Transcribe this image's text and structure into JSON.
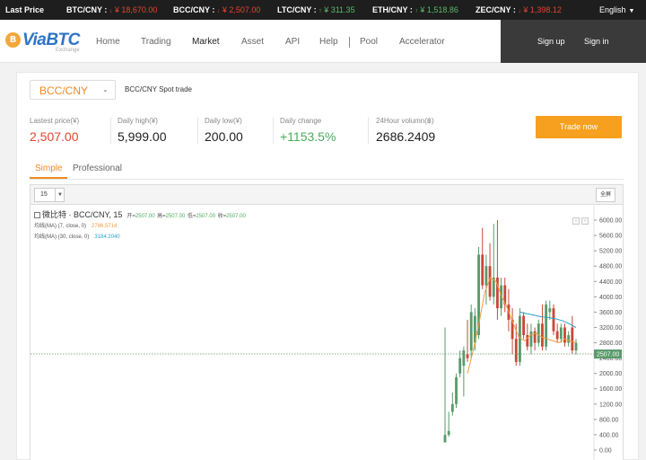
{
  "ticker": {
    "last_price_label": "Last Price",
    "items": [
      {
        "pair": "BTC/CNY :",
        "price": "¥ 18,670.00",
        "dir": "down"
      },
      {
        "pair": "BCC/CNY :",
        "price": "¥ 2,507.00",
        "dir": "down"
      },
      {
        "pair": "LTC/CNY :",
        "price": "¥ 311.35",
        "dir": "up"
      },
      {
        "pair": "ETH/CNY :",
        "price": "¥ 1,518.86",
        "dir": "up"
      },
      {
        "pair": "ZEC/CNY :",
        "price": "¥ 1,398.12",
        "dir": "down"
      }
    ],
    "language": "English"
  },
  "header": {
    "logo_text": "ViaBTC",
    "logo_sub": "Exchange",
    "nav": [
      "Home",
      "Trading",
      "Market",
      "Asset",
      "API",
      "Help",
      "Pool",
      "Accelerator"
    ],
    "active_nav": "Market",
    "sign_up": "Sign up",
    "sign_in": "Sign in"
  },
  "market": {
    "pair": "BCC/CNY",
    "spot_label": "BCC/CNY Spot trade",
    "stats": [
      {
        "label": "Lastest price(¥)",
        "value": "2,507.00",
        "color": "red"
      },
      {
        "label": "Daily high(¥)",
        "value": "5,999.00",
        "color": "normal"
      },
      {
        "label": "Daily low(¥)",
        "value": "200.00",
        "color": "normal"
      },
      {
        "label": "Daily change",
        "value": "+1153.5%",
        "color": "green"
      },
      {
        "label": "24Hour volumn(฿)",
        "value": "2686.2409",
        "color": "normal"
      }
    ],
    "trade_button": "Trade now",
    "tabs": [
      "Simple",
      "Professional"
    ],
    "active_tab": "Simple"
  },
  "chart_toolbar": {
    "interval": "15",
    "fullscreen_label": "全屏"
  },
  "chart_legend": {
    "title": "微比特 · BCC/CNY, 15",
    "ohlc": [
      {
        "label": "开=",
        "value": "2507.00"
      },
      {
        "label": "高=",
        "value": "2507.00"
      },
      {
        "label": "低=",
        "value": "2507.00"
      },
      {
        "label": "收=",
        "value": "2507.00"
      }
    ],
    "ma7": {
      "label": "均线(MA) (7, close, 0)",
      "value": "2786.5714"
    },
    "ma30": {
      "label": "均线(MA) (30, close, 0)",
      "value": "3184.2040"
    }
  },
  "chart_data": {
    "type": "candlestick",
    "ylim": [
      0,
      6000
    ],
    "y_ticks": [
      "0.00",
      "400.00",
      "800.00",
      "1200.00",
      "1600.00",
      "2000.00",
      "2400.00",
      "2800.00",
      "3200.00",
      "3600.00",
      "4000.00",
      "4400.00",
      "4800.00",
      "5200.00",
      "5600.00",
      "6000.00"
    ],
    "current_price": 2507.0,
    "current_price_label": "2507.00",
    "candles": [
      {
        "o": 200,
        "h": 3200,
        "l": 200,
        "c": 400
      },
      {
        "o": 400,
        "h": 1000,
        "l": 350,
        "c": 500
      },
      {
        "o": 1000,
        "h": 1500,
        "l": 900,
        "c": 1200
      },
      {
        "o": 1200,
        "h": 2000,
        "l": 1100,
        "c": 1900
      },
      {
        "o": 2000,
        "h": 2600,
        "l": 1900,
        "c": 2400
      },
      {
        "o": 2200,
        "h": 2700,
        "l": 1400,
        "c": 2600
      },
      {
        "o": 2500,
        "h": 3400,
        "l": 2300,
        "c": 2400
      },
      {
        "o": 2600,
        "h": 3800,
        "l": 2400,
        "c": 3600
      },
      {
        "o": 2800,
        "h": 3700,
        "l": 2600,
        "c": 3500
      },
      {
        "o": 3000,
        "h": 5300,
        "l": 2900,
        "c": 5100
      },
      {
        "o": 5100,
        "h": 5800,
        "l": 4200,
        "c": 4300
      },
      {
        "o": 4300,
        "h": 5100,
        "l": 3800,
        "c": 4800
      },
      {
        "o": 4800,
        "h": 5400,
        "l": 3900,
        "c": 4000
      },
      {
        "o": 4000,
        "h": 5900,
        "l": 3800,
        "c": 4500
      },
      {
        "o": 4500,
        "h": 6000,
        "l": 3400,
        "c": 3700
      },
      {
        "o": 3700,
        "h": 4500,
        "l": 3500,
        "c": 4300
      },
      {
        "o": 4300,
        "h": 4500,
        "l": 3600,
        "c": 3800
      },
      {
        "o": 3800,
        "h": 4200,
        "l": 3100,
        "c": 3400
      },
      {
        "o": 3400,
        "h": 3700,
        "l": 2500,
        "c": 2900
      },
      {
        "o": 2900,
        "h": 3300,
        "l": 2200,
        "c": 2300
      },
      {
        "o": 2300,
        "h": 3700,
        "l": 2200,
        "c": 3500
      },
      {
        "o": 3500,
        "h": 3600,
        "l": 2900,
        "c": 3000
      },
      {
        "o": 3000,
        "h": 3300,
        "l": 2600,
        "c": 2700
      },
      {
        "o": 2700,
        "h": 3300,
        "l": 2500,
        "c": 3100
      },
      {
        "o": 3100,
        "h": 3200,
        "l": 2600,
        "c": 2800
      },
      {
        "o": 2800,
        "h": 3400,
        "l": 2700,
        "c": 3300
      },
      {
        "o": 3300,
        "h": 3800,
        "l": 2600,
        "c": 2700
      },
      {
        "o": 2700,
        "h": 3900,
        "l": 2600,
        "c": 3800
      },
      {
        "o": 3600,
        "h": 3900,
        "l": 3400,
        "c": 3700
      },
      {
        "o": 3700,
        "h": 3800,
        "l": 3000,
        "c": 3100
      },
      {
        "o": 3100,
        "h": 3300,
        "l": 2800,
        "c": 2900
      },
      {
        "o": 2900,
        "h": 3300,
        "l": 2800,
        "c": 3200
      },
      {
        "o": 3200,
        "h": 3300,
        "l": 2700,
        "c": 2800
      },
      {
        "o": 2800,
        "h": 3100,
        "l": 2700,
        "c": 3000
      },
      {
        "o": 3200,
        "h": 3500,
        "l": 2500,
        "c": 2600
      },
      {
        "o": 2600,
        "h": 2900,
        "l": 2500,
        "c": 2800
      }
    ],
    "series": [
      {
        "name": "均线(MA) (7, close, 0)",
        "values": [
          2000,
          2600,
          3300,
          4100,
          4500,
          4400,
          4000,
          3700,
          3300,
          2950,
          2850,
          3000,
          3050,
          2950,
          2900,
          2850,
          2800,
          2900,
          2850,
          2800
        ]
      },
      {
        "name": "均线(MA) (30, close, 0)",
        "values": [
          3600,
          3560,
          3520,
          3480,
          3460,
          3430,
          3380,
          3300,
          3200
        ]
      }
    ],
    "colors": {
      "up": "#5a9a6b",
      "down": "#c9483a",
      "ma7": "#f39c3c",
      "ma30": "#2aa1c9"
    },
    "grid": false
  }
}
